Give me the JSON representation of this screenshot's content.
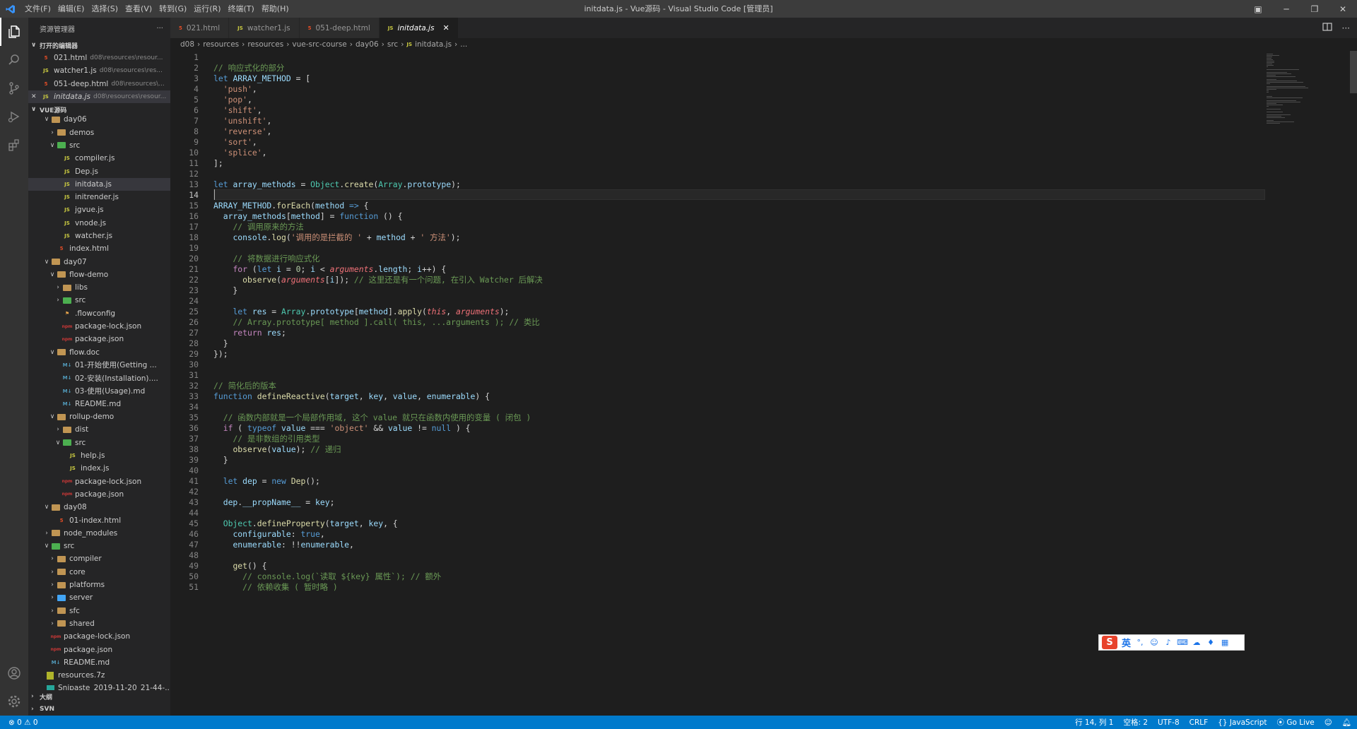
{
  "app": {
    "window_title": "initdata.js - Vue源码 - Visual Studio Code [管理员]",
    "menu": [
      "文件(F)",
      "编辑(E)",
      "选择(S)",
      "查看(V)",
      "转到(G)",
      "运行(R)",
      "终端(T)",
      "帮助(H)"
    ]
  },
  "sidebar": {
    "title": "资源管理器",
    "more": "···",
    "open_editors_label": "打开的编辑器",
    "open_editors": [
      {
        "name": "021.html",
        "desc": "d08\\resources\\resour...",
        "type": "html"
      },
      {
        "name": "watcher1.js",
        "desc": "d08\\resources\\res...",
        "type": "js"
      },
      {
        "name": "051-deep.html",
        "desc": "d08\\resources\\...",
        "type": "html"
      },
      {
        "name": "initdata.js",
        "desc": "d08\\resources\\resour...",
        "type": "js",
        "close": "✕"
      }
    ],
    "workspace_label": "VUE源码",
    "tree": [
      {
        "label": "day06",
        "indent": 2,
        "twisty": "v",
        "icon": "folder"
      },
      {
        "label": "demos",
        "indent": 3,
        "twisty": ">",
        "icon": "folder"
      },
      {
        "label": "src",
        "indent": 3,
        "twisty": "v",
        "icon": "folder-src"
      },
      {
        "label": "compiler.js",
        "indent": 4,
        "twisty": "",
        "icon": "js"
      },
      {
        "label": "Dep.js",
        "indent": 4,
        "twisty": "",
        "icon": "js"
      },
      {
        "label": "initdata.js",
        "indent": 4,
        "twisty": "",
        "icon": "js",
        "selected": true
      },
      {
        "label": "initrender.js",
        "indent": 4,
        "twisty": "",
        "icon": "js"
      },
      {
        "label": "jgvue.js",
        "indent": 4,
        "twisty": "",
        "icon": "js"
      },
      {
        "label": "vnode.js",
        "indent": 4,
        "twisty": "",
        "icon": "js"
      },
      {
        "label": "watcher.js",
        "indent": 4,
        "twisty": "",
        "icon": "js"
      },
      {
        "label": "index.html",
        "indent": 3,
        "twisty": "",
        "icon": "html"
      },
      {
        "label": "day07",
        "indent": 2,
        "twisty": "v",
        "icon": "folder"
      },
      {
        "label": "flow-demo",
        "indent": 3,
        "twisty": "v",
        "icon": "folder"
      },
      {
        "label": "libs",
        "indent": 4,
        "twisty": ">",
        "icon": "folder"
      },
      {
        "label": "src",
        "indent": 4,
        "twisty": ">",
        "icon": "folder-src"
      },
      {
        "label": ".flowconfig",
        "indent": 4,
        "twisty": "",
        "icon": "cfg"
      },
      {
        "label": "package-lock.json",
        "indent": 4,
        "twisty": "",
        "icon": "npm"
      },
      {
        "label": "package.json",
        "indent": 4,
        "twisty": "",
        "icon": "npm"
      },
      {
        "label": "flow.doc",
        "indent": 3,
        "twisty": "v",
        "icon": "folder"
      },
      {
        "label": "01-开始使用(Getting ...",
        "indent": 4,
        "twisty": "",
        "icon": "md"
      },
      {
        "label": "02-安装(Installation)....",
        "indent": 4,
        "twisty": "",
        "icon": "md"
      },
      {
        "label": "03-使用(Usage).md",
        "indent": 4,
        "twisty": "",
        "icon": "md"
      },
      {
        "label": "README.md",
        "indent": 4,
        "twisty": "",
        "icon": "md"
      },
      {
        "label": "rollup-demo",
        "indent": 3,
        "twisty": "v",
        "icon": "folder"
      },
      {
        "label": "dist",
        "indent": 4,
        "twisty": ">",
        "icon": "folder"
      },
      {
        "label": "src",
        "indent": 4,
        "twisty": "v",
        "icon": "folder-src"
      },
      {
        "label": "help.js",
        "indent": 5,
        "twisty": "",
        "icon": "js"
      },
      {
        "label": "index.js",
        "indent": 5,
        "twisty": "",
        "icon": "js"
      },
      {
        "label": "package-lock.json",
        "indent": 4,
        "twisty": "",
        "icon": "npm"
      },
      {
        "label": "package.json",
        "indent": 4,
        "twisty": "",
        "icon": "npm"
      },
      {
        "label": "day08",
        "indent": 2,
        "twisty": "v",
        "icon": "folder"
      },
      {
        "label": "01-index.html",
        "indent": 3,
        "twisty": "",
        "icon": "html"
      },
      {
        "label": "node_modules",
        "indent": 2,
        "twisty": ">",
        "icon": "folder"
      },
      {
        "label": "src",
        "indent": 2,
        "twisty": "v",
        "icon": "folder-src"
      },
      {
        "label": "compiler",
        "indent": 3,
        "twisty": ">",
        "icon": "folder"
      },
      {
        "label": "core",
        "indent": 3,
        "twisty": ">",
        "icon": "folder"
      },
      {
        "label": "platforms",
        "indent": 3,
        "twisty": ">",
        "icon": "folder"
      },
      {
        "label": "server",
        "indent": 3,
        "twisty": ">",
        "icon": "folder-blue"
      },
      {
        "label": "sfc",
        "indent": 3,
        "twisty": ">",
        "icon": "folder"
      },
      {
        "label": "shared",
        "indent": 3,
        "twisty": ">",
        "icon": "folder"
      },
      {
        "label": "package-lock.json",
        "indent": 2,
        "twisty": "",
        "icon": "npm"
      },
      {
        "label": "package.json",
        "indent": 2,
        "twisty": "",
        "icon": "npm"
      },
      {
        "label": "README.md",
        "indent": 2,
        "twisty": "",
        "icon": "md"
      },
      {
        "label": "resources.7z",
        "indent": 1,
        "twisty": "",
        "icon": "zip"
      },
      {
        "label": "Snipaste_2019-11-20_21-44-...",
        "indent": 1,
        "twisty": "",
        "icon": "img"
      }
    ],
    "outline_label": "大纲",
    "svn_label": "SVN"
  },
  "tabs": [
    {
      "label": "021.html",
      "type": "html"
    },
    {
      "label": "watcher1.js",
      "type": "js"
    },
    {
      "label": "051-deep.html",
      "type": "html"
    },
    {
      "label": "initdata.js",
      "type": "js",
      "active": true,
      "close": "✕"
    }
  ],
  "breadcrumb": [
    "d08",
    "resources",
    "resources",
    "vue-src-course",
    "day06",
    "src",
    "initdata.js",
    "..."
  ],
  "editor": {
    "current_line": 14,
    "lines": [
      [],
      [
        [
          "c",
          "// 响应式化的部分"
        ]
      ],
      [
        [
          "k",
          "let "
        ],
        [
          "v",
          "ARRAY_METHOD"
        ],
        [
          "sm",
          " = ["
        ]
      ],
      [
        [
          "sm",
          "  "
        ],
        [
          "s",
          "'push'"
        ],
        [
          "sm",
          ","
        ]
      ],
      [
        [
          "sm",
          "  "
        ],
        [
          "s",
          "'pop'"
        ],
        [
          "sm",
          ","
        ]
      ],
      [
        [
          "sm",
          "  "
        ],
        [
          "s",
          "'shift'"
        ],
        [
          "sm",
          ","
        ]
      ],
      [
        [
          "sm",
          "  "
        ],
        [
          "s",
          "'unshift'"
        ],
        [
          "sm",
          ","
        ]
      ],
      [
        [
          "sm",
          "  "
        ],
        [
          "s",
          "'reverse'"
        ],
        [
          "sm",
          ","
        ]
      ],
      [
        [
          "sm",
          "  "
        ],
        [
          "s",
          "'sort'"
        ],
        [
          "sm",
          ","
        ]
      ],
      [
        [
          "sm",
          "  "
        ],
        [
          "s",
          "'splice'"
        ],
        [
          "sm",
          ","
        ]
      ],
      [
        [
          "sm",
          "];"
        ]
      ],
      [],
      [
        [
          "k",
          "let "
        ],
        [
          "v",
          "array_methods"
        ],
        [
          "sm",
          " = "
        ],
        [
          "cl",
          "Object"
        ],
        [
          "sm",
          "."
        ],
        [
          "fn",
          "create"
        ],
        [
          "sm",
          "("
        ],
        [
          "cl",
          "Array"
        ],
        [
          "sm",
          "."
        ],
        [
          "v",
          "prototype"
        ],
        [
          "sm",
          ");"
        ]
      ],
      [],
      [
        [
          "v",
          "ARRAY_METHOD"
        ],
        [
          "sm",
          "."
        ],
        [
          "fn",
          "forEach"
        ],
        [
          "sm",
          "("
        ],
        [
          "v",
          "method"
        ],
        [
          "sm",
          " "
        ],
        [
          "k",
          "=>"
        ],
        [
          "sm",
          " {"
        ]
      ],
      [
        [
          "sm",
          "  "
        ],
        [
          "v",
          "array_methods"
        ],
        [
          "sm",
          "["
        ],
        [
          "v",
          "method"
        ],
        [
          "sm",
          "] = "
        ],
        [
          "k",
          "function"
        ],
        [
          "sm",
          " () {"
        ]
      ],
      [
        [
          "sm",
          "    "
        ],
        [
          "c",
          "// 调用原来的方法"
        ]
      ],
      [
        [
          "sm",
          "    "
        ],
        [
          "v",
          "console"
        ],
        [
          "sm",
          "."
        ],
        [
          "fn",
          "log"
        ],
        [
          "sm",
          "("
        ],
        [
          "s",
          "'调用的是拦截的 '"
        ],
        [
          "sm",
          " + "
        ],
        [
          "v",
          "method"
        ],
        [
          "sm",
          " + "
        ],
        [
          "s",
          "' 方法'"
        ],
        [
          "sm",
          ");"
        ]
      ],
      [],
      [
        [
          "sm",
          "    "
        ],
        [
          "c",
          "// 将数据进行响应式化"
        ]
      ],
      [
        [
          "sm",
          "    "
        ],
        [
          "kf",
          "for"
        ],
        [
          "sm",
          " ("
        ],
        [
          "k",
          "let "
        ],
        [
          "v",
          "i"
        ],
        [
          "sm",
          " = "
        ],
        [
          "n",
          "0"
        ],
        [
          "sm",
          "; "
        ],
        [
          "v",
          "i"
        ],
        [
          "sm",
          " < "
        ],
        [
          "it",
          "arguments"
        ],
        [
          "sm",
          "."
        ],
        [
          "v",
          "length"
        ],
        [
          "sm",
          "; "
        ],
        [
          "v",
          "i"
        ],
        [
          "sm",
          "++) {"
        ]
      ],
      [
        [
          "sm",
          "      "
        ],
        [
          "fn",
          "observe"
        ],
        [
          "sm",
          "("
        ],
        [
          "it",
          "arguments"
        ],
        [
          "sm",
          "["
        ],
        [
          "v",
          "i"
        ],
        [
          "sm",
          "]); "
        ],
        [
          "c",
          "// 这里还是有一个问题, 在引入 Watcher 后解决"
        ]
      ],
      [
        [
          "sm",
          "    }"
        ]
      ],
      [],
      [
        [
          "sm",
          "    "
        ],
        [
          "k",
          "let "
        ],
        [
          "v",
          "res"
        ],
        [
          "sm",
          " = "
        ],
        [
          "cl",
          "Array"
        ],
        [
          "sm",
          "."
        ],
        [
          "v",
          "prototype"
        ],
        [
          "sm",
          "["
        ],
        [
          "v",
          "method"
        ],
        [
          "sm",
          "]."
        ],
        [
          "fn",
          "apply"
        ],
        [
          "sm",
          "("
        ],
        [
          "it",
          "this"
        ],
        [
          "sm",
          ", "
        ],
        [
          "it",
          "arguments"
        ],
        [
          "sm",
          ");"
        ]
      ],
      [
        [
          "sm",
          "    "
        ],
        [
          "c",
          "// Array.prototype[ method ].call( this, ...arguments ); // 类比"
        ]
      ],
      [
        [
          "sm",
          "    "
        ],
        [
          "kf",
          "return"
        ],
        [
          "sm",
          " "
        ],
        [
          "v",
          "res"
        ],
        [
          "sm",
          ";"
        ]
      ],
      [
        [
          "sm",
          "  }"
        ]
      ],
      [
        [
          "sm",
          "});"
        ]
      ],
      [],
      [],
      [
        [
          "c",
          "// 简化后的版本"
        ]
      ],
      [
        [
          "k",
          "function "
        ],
        [
          "fn",
          "defineReactive"
        ],
        [
          "sm",
          "("
        ],
        [
          "v",
          "target"
        ],
        [
          "sm",
          ", "
        ],
        [
          "v",
          "key"
        ],
        [
          "sm",
          ", "
        ],
        [
          "v",
          "value"
        ],
        [
          "sm",
          ", "
        ],
        [
          "v",
          "enumerable"
        ],
        [
          "sm",
          ") {"
        ]
      ],
      [],
      [
        [
          "sm",
          "  "
        ],
        [
          "c",
          "// 函数内部就是一个局部作用域, 这个 value 就只在函数内使用的变量 ( 闭包 )"
        ]
      ],
      [
        [
          "sm",
          "  "
        ],
        [
          "kf",
          "if"
        ],
        [
          "sm",
          " ( "
        ],
        [
          "k",
          "typeof "
        ],
        [
          "v",
          "value"
        ],
        [
          "sm",
          " === "
        ],
        [
          "s",
          "'object'"
        ],
        [
          "sm",
          " && "
        ],
        [
          "v",
          "value"
        ],
        [
          "sm",
          " != "
        ],
        [
          "k",
          "null"
        ],
        [
          "sm",
          " ) {"
        ]
      ],
      [
        [
          "sm",
          "    "
        ],
        [
          "c",
          "// 是非数组的引用类型"
        ]
      ],
      [
        [
          "sm",
          "    "
        ],
        [
          "fn",
          "observe"
        ],
        [
          "sm",
          "("
        ],
        [
          "v",
          "value"
        ],
        [
          "sm",
          "); "
        ],
        [
          "c",
          "// 递归"
        ]
      ],
      [
        [
          "sm",
          "  }"
        ]
      ],
      [],
      [
        [
          "sm",
          "  "
        ],
        [
          "k",
          "let "
        ],
        [
          "v",
          "dep"
        ],
        [
          "sm",
          " = "
        ],
        [
          "k",
          "new "
        ],
        [
          "fn",
          "Dep"
        ],
        [
          "sm",
          "();"
        ]
      ],
      [],
      [
        [
          "sm",
          "  "
        ],
        [
          "v",
          "dep"
        ],
        [
          "sm",
          "."
        ],
        [
          "v",
          "__propName__"
        ],
        [
          "sm",
          " = "
        ],
        [
          "v",
          "key"
        ],
        [
          "sm",
          ";"
        ]
      ],
      [],
      [
        [
          "sm",
          "  "
        ],
        [
          "cl",
          "Object"
        ],
        [
          "sm",
          "."
        ],
        [
          "fn",
          "defineProperty"
        ],
        [
          "sm",
          "("
        ],
        [
          "v",
          "target"
        ],
        [
          "sm",
          ", "
        ],
        [
          "v",
          "key"
        ],
        [
          "sm",
          ", {"
        ]
      ],
      [
        [
          "sm",
          "    "
        ],
        [
          "v",
          "configurable"
        ],
        [
          "sm",
          ": "
        ],
        [
          "k",
          "true"
        ],
        [
          "sm",
          ","
        ]
      ],
      [
        [
          "sm",
          "    "
        ],
        [
          "v",
          "enumerable"
        ],
        [
          "sm",
          ": !!"
        ],
        [
          "v",
          "enumerable"
        ],
        [
          "sm",
          ","
        ]
      ],
      [],
      [
        [
          "sm",
          "    "
        ],
        [
          "fn",
          "get"
        ],
        [
          "sm",
          "() {"
        ]
      ],
      [
        [
          "sm",
          "      "
        ],
        [
          "c",
          "// console.log(`读取 ${key} 属性`); // 额外"
        ]
      ],
      [
        [
          "sm",
          "      "
        ],
        [
          "c",
          "// 依赖收集 ( 暂时略 )"
        ]
      ]
    ]
  },
  "ime": {
    "logo": "S",
    "lang": "英"
  },
  "statusbar": {
    "errors": "⊗ 0 ⚠ 0",
    "position": "行 14, 列 1",
    "spaces": "空格: 2",
    "encoding": "UTF-8",
    "eol": "CRLF",
    "language": "{} JavaScript",
    "golive": "Go Live"
  }
}
